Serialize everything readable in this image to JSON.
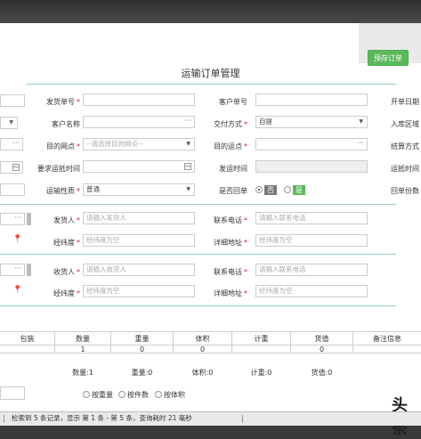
{
  "header": {
    "save_button": "预存订单",
    "title": "运输订单管理"
  },
  "form": {
    "row1": {
      "ship_no_label": "发货单号",
      "customer_no_label": "客户单号",
      "open_date_label": "开单日期"
    },
    "row2": {
      "customer_name_label": "客户名称",
      "delivery_method_label": "交付方式",
      "delivery_method_value": "自提",
      "warehouse_area_label": "入库区域"
    },
    "row3": {
      "dest_site_label": "目的网点",
      "dest_site_placeholder": "--请选择目的网点--",
      "dest_station_label": "目的运点",
      "settle_method_label": "结算方式"
    },
    "row4": {
      "req_arrival_label": "要求运抵时间",
      "ship_time_label": "发运时间",
      "arrival_time_label": "运抵时间"
    },
    "row5": {
      "transport_nature_label": "运输性质",
      "transport_nature_value": "普通",
      "receipt_label": "是否回单",
      "receipt_no": "否",
      "receipt_yes": "是",
      "receipt_copies_label": "回单份数"
    },
    "shipper": {
      "name_label": "发货人",
      "name_placeholder": "请输入发货人",
      "phone_label": "联系电话",
      "phone_placeholder": "请输入联系电话",
      "coords_label": "经纬度",
      "coords_placeholder": "经纬度为空",
      "address_label": "详细地址",
      "address_placeholder": "经纬度为空"
    },
    "receiver": {
      "name_label": "收货人",
      "name_placeholder": "请输入收货人",
      "phone_label": "联系电话",
      "phone_placeholder": "请输入联系电话",
      "coords_label": "经纬度",
      "coords_placeholder": "经纬度为空",
      "address_label": "详细地址",
      "address_placeholder": "经纬度为空"
    }
  },
  "table": {
    "headers": [
      "包装",
      "数量",
      "重量",
      "体积",
      "计重",
      "货值",
      "备注信息"
    ],
    "row": [
      "",
      "1",
      "0",
      "0",
      "",
      "0",
      ""
    ],
    "totals": {
      "quantity": "数量:1",
      "weight": "重量:0",
      "volume": "体积:0",
      "charge_weight": "计重:0",
      "value": "货值:0"
    }
  },
  "calc": {
    "by_weight": "按重量",
    "by_count": "按件数",
    "by_volume": "按体积"
  },
  "status": {
    "text": "检索到 5 条记录，显示 第 1 条 - 第 5 条，查询耗时 21 毫秒"
  },
  "watermark": "头条"
}
